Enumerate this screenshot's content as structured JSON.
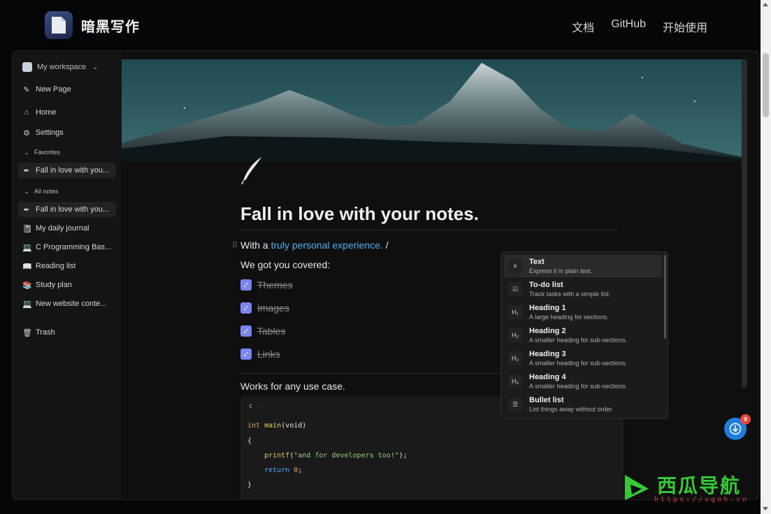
{
  "site": {
    "title": "暗黑写作",
    "nav": [
      "文档",
      "GitHub",
      "开始使用"
    ]
  },
  "sidebar": {
    "workspace": "My workspace",
    "new_page": "New Page",
    "home": "Home",
    "settings": "Settings",
    "favorites_label": "Favorites",
    "favorites": [
      {
        "icon": "feather-icon",
        "glyph": "✒",
        "label": "Fall in love with you..."
      }
    ],
    "all_notes_label": "All notes",
    "notes": [
      {
        "icon": "feather-icon",
        "glyph": "✒",
        "label": "Fall in love with you..."
      },
      {
        "icon": "notebook-icon",
        "glyph": "📓",
        "label": "My daily journal"
      },
      {
        "icon": "laptop-icon",
        "glyph": "💻",
        "label": "C Programming Bas..."
      },
      {
        "icon": "book-icon",
        "glyph": "📖",
        "label": "Reading list"
      },
      {
        "icon": "books-icon",
        "glyph": "📚",
        "label": "Study plan"
      },
      {
        "icon": "laptop-icon",
        "glyph": "💻",
        "label": "New website conte..."
      }
    ],
    "trash": "Trash"
  },
  "editor": {
    "title": "Fall in love with your notes.",
    "line1_prefix": "With a ",
    "line1_link": "truly personal experience.",
    "line1_suffix": " /",
    "line2": "We got you covered:",
    "todos": [
      "Themes",
      "Images",
      "Tables",
      "Links"
    ],
    "line3": "Works for any use case.",
    "code_lang": "c",
    "code": {
      "l1_kw": "int ",
      "l1_fn": "main",
      "l1_rest": "(void)",
      "l2": "{",
      "l3_fn": "    printf",
      "l3_open": "(",
      "l3_str": "\"and for developers too!\"",
      "l3_close": ");",
      "l4_kw": "    return ",
      "l4_num": "0",
      "l4_end": ";",
      "l5": "}"
    }
  },
  "slash_menu": [
    {
      "icon": "text-icon",
      "glyph": "≡",
      "title": "Text",
      "desc": "Express it in plain text."
    },
    {
      "icon": "checkbox-icon",
      "glyph": "☑",
      "title": "To-do list",
      "desc": "Track tasks with a simple list."
    },
    {
      "icon": "heading1-icon",
      "glyph": "H₁",
      "title": "Heading 1",
      "desc": "A large heading for sections."
    },
    {
      "icon": "heading2-icon",
      "glyph": "H₂",
      "title": "Heading 2",
      "desc": "A smaller heading for sub-sections."
    },
    {
      "icon": "heading3-icon",
      "glyph": "H₃",
      "title": "Heading 3",
      "desc": "A smaller heading for sub-sections."
    },
    {
      "icon": "heading4-icon",
      "glyph": "H₄",
      "title": "Heading 4",
      "desc": "A smaller heading for sub-sections."
    },
    {
      "icon": "bullet-list-icon",
      "glyph": "☰",
      "title": "Bullet list",
      "desc": "List things away without order."
    }
  ],
  "fab_badge": "9",
  "watermark": {
    "text": "西瓜导航",
    "url": "https://xgoh.cn"
  },
  "colors": {
    "accent": "#7b86f5",
    "link": "#4ab0f0",
    "fab": "#1f7de0"
  }
}
